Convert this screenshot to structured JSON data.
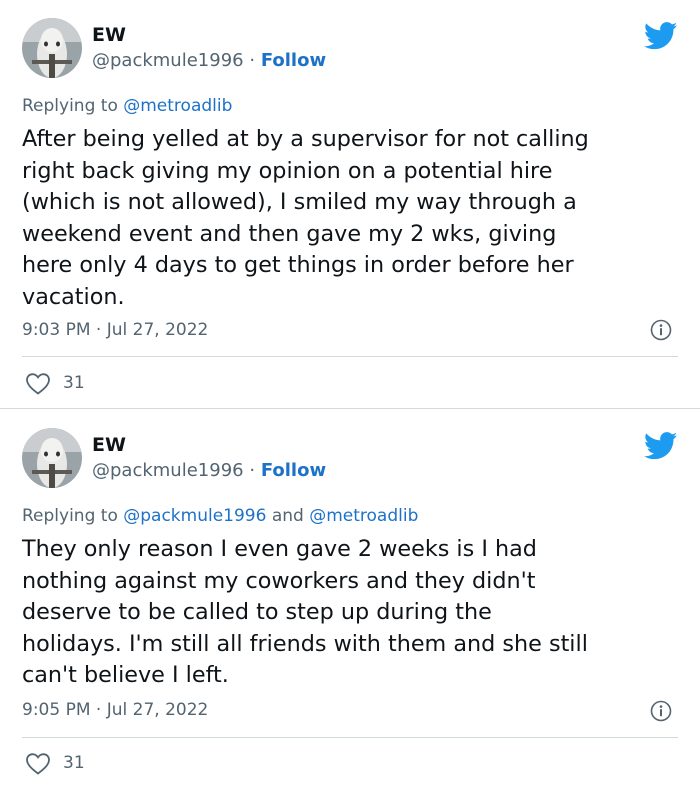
{
  "tweets": [
    {
      "author_name": "EW",
      "handle": "@packmule1996",
      "separator": "·",
      "follow_label": "Follow",
      "replying_prefix": "Replying to",
      "replying_to": [
        "@metroadlib"
      ],
      "replying_join": "",
      "body_lines": [
        "After being yelled at by a supervisor for not calling",
        "right back giving my opinion on a potential hire",
        "(which is not allowed), I smiled my way through a",
        "weekend event and then gave my 2 wks, giving",
        "here only 4 days to get things in order before her",
        "vacation."
      ],
      "timestamp": "9:03 PM · Jul 27, 2022",
      "likes": "31"
    },
    {
      "author_name": "EW",
      "handle": "@packmule1996",
      "separator": "·",
      "follow_label": "Follow",
      "replying_prefix": "Replying to",
      "replying_to": [
        "@packmule1996",
        "@metroadlib"
      ],
      "replying_join": "and",
      "body_lines": [
        "They only reason I even gave 2 weeks is I had",
        "nothing against my coworkers and they didn't",
        "deserve to be called to step up during the",
        "holidays. I'm still all friends with them and she still",
        "can't believe I left."
      ],
      "timestamp": "9:05 PM · Jul 27, 2022",
      "likes": "31"
    }
  ],
  "colors": {
    "link": "#1d72c8",
    "twitter_blue": "#1d9bf0",
    "muted_text": "#536471",
    "divider": "#cfd9de"
  },
  "icons": {
    "brand": "twitter-bird-icon",
    "info": "info-icon",
    "like": "heart-icon"
  }
}
